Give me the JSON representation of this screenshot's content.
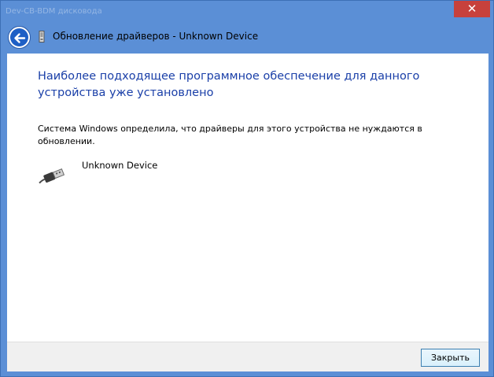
{
  "window": {
    "caption_background_text": "Dev-CB-BDM дисковода",
    "title": "Обновление драйверов - Unknown Device",
    "close_symbol": "✕"
  },
  "icons": {
    "back": "back-arrow-icon",
    "title": "device-driver-icon",
    "device": "usb-connector-icon",
    "close": "close-icon"
  },
  "content": {
    "heading": "Наиболее подходящее программное обеспечение для данного устройства уже установлено",
    "description": "Система Windows определила, что драйверы для этого устройства не нуждаются в обновлении.",
    "device_name": "Unknown Device"
  },
  "footer": {
    "close_label": "Закрыть"
  },
  "colors": {
    "frame": "#5b8fd6",
    "close_button": "#c7413c",
    "heading": "#1a3fa8"
  }
}
